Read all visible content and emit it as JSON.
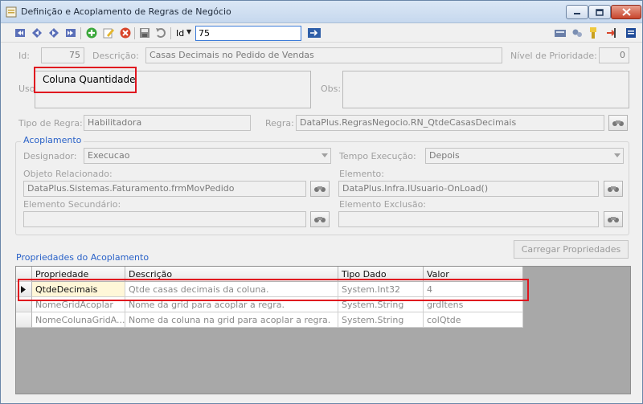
{
  "window": {
    "title": "Definição e Acoplamento de Regras de Negócio"
  },
  "toolbar": {
    "id_label": "Id",
    "id_value": "75"
  },
  "form": {
    "id_label": "Id:",
    "id_value": "75",
    "description_label": "Descrição:",
    "description_value": "Casas Decimais no Pedido de Vendas",
    "priority_label": "Nível de Prioridade:",
    "priority_value": "0",
    "usage_label": "Uso:",
    "usage_value": "Coluna Quantidade",
    "obs_label": "Obs:",
    "obs_value": "",
    "rule_type_label": "Tipo de Regra:",
    "rule_type_value": "Habilitadora",
    "rule_label": "Regra:",
    "rule_value": "DataPlus.RegrasNegocio.RN_QtdeCasasDecimais"
  },
  "coupling": {
    "title": "Acoplamento",
    "designator_label": "Designador:",
    "designator_value": "Execucao",
    "exec_time_label": "Tempo Execução:",
    "exec_time_value": "Depois",
    "related_object_label": "Objeto Relacionado:",
    "related_object_value": "DataPlus.Sistemas.Faturamento.frmMovPedido",
    "element_label": "Elemento:",
    "element_value": "DataPlus.Infra.IUsuario-OnLoad()",
    "secondary_element_label": "Elemento Secundário:",
    "secondary_element_value": "",
    "exclusion_element_label": "Elemento Exclusão:",
    "exclusion_element_value": ""
  },
  "properties": {
    "title": "Propriedades do Acoplamento",
    "load_button": "Carregar Propriedades",
    "columns": [
      "Propriedade",
      "Descrição",
      "Tipo Dado",
      "Valor"
    ],
    "rows": [
      [
        "QtdeDecimais",
        "Qtde casas decimais da coluna.",
        "System.Int32",
        "4"
      ],
      [
        "NomeGridAcoplar",
        "Nome da grid para acoplar a regra.",
        "System.String",
        "grdItens"
      ],
      [
        "NomeColunaGridA...",
        "Nome da coluna na grid para acoplar a regra.",
        "System.String",
        "colQtde"
      ]
    ]
  },
  "colors": {
    "highlight": "#e0151f",
    "accent_blue": "#2a62c8",
    "selected_row": "#fff7d8"
  }
}
